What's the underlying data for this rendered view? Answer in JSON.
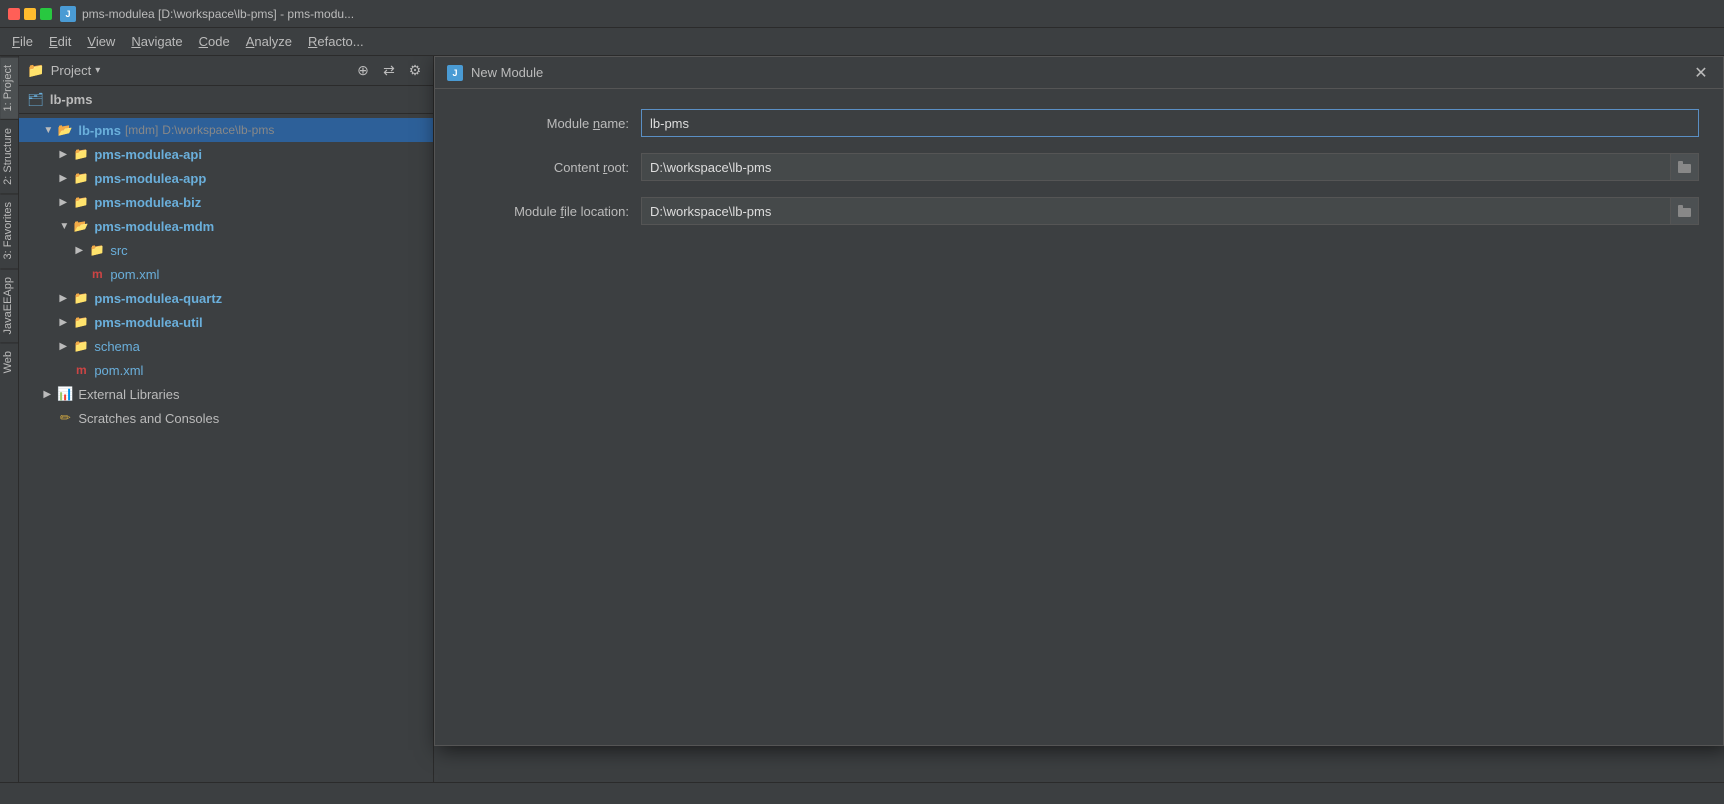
{
  "titleBar": {
    "icon": "J",
    "title": "pms-modulea [D:\\workspace\\lb-pms] - pms-modu...",
    "windowControls": [
      "red",
      "yellow",
      "green"
    ]
  },
  "menuBar": {
    "items": [
      {
        "label": "File",
        "underline": "F"
      },
      {
        "label": "Edit",
        "underline": "E"
      },
      {
        "label": "View",
        "underline": "V"
      },
      {
        "label": "Navigate",
        "underline": "N"
      },
      {
        "label": "Code",
        "underline": "C"
      },
      {
        "label": "Analyze",
        "underline": "A"
      },
      {
        "label": "Refacto...",
        "underline": "R"
      }
    ]
  },
  "projectPanel": {
    "label": "1: Project",
    "header": {
      "title": "Project",
      "dropdown": "▾"
    },
    "tree": {
      "rootItem": {
        "name": "lb-pms",
        "badge": "[mdm]",
        "path": "D:\\workspace\\lb-pms",
        "expanded": true,
        "selected": false,
        "children": [
          {
            "name": "pms-modulea-api",
            "type": "module",
            "expanded": false
          },
          {
            "name": "pms-modulea-app",
            "type": "module",
            "expanded": false
          },
          {
            "name": "pms-modulea-biz",
            "type": "module",
            "expanded": false
          },
          {
            "name": "pms-modulea-mdm",
            "type": "module",
            "expanded": true,
            "children": [
              {
                "name": "src",
                "type": "folder",
                "expanded": false
              },
              {
                "name": "pom.xml",
                "type": "maven"
              }
            ]
          },
          {
            "name": "pms-modulea-quartz",
            "type": "module",
            "expanded": false
          },
          {
            "name": "pms-modulea-util",
            "type": "module",
            "expanded": false
          },
          {
            "name": "schema",
            "type": "folder",
            "expanded": false
          },
          {
            "name": "pom.xml",
            "type": "maven"
          }
        ]
      },
      "externalLibraries": {
        "name": "External Libraries",
        "type": "external"
      },
      "scratchesConsoles": {
        "name": "Scratches and Consoles",
        "type": "scratch"
      }
    }
  },
  "sideLabels": {
    "left": [
      "Structure",
      "Favorites",
      "JavaEEApp",
      "Web"
    ],
    "right": []
  },
  "dialog": {
    "title": "New Module",
    "closeButton": "✕",
    "fields": {
      "moduleName": {
        "label": "Module name:",
        "value": "lb-pms",
        "underline": "n"
      },
      "contentRoot": {
        "label": "Content root:",
        "value": "D:\\workspace\\lb-pms",
        "underline": "r",
        "hasBrowse": true
      },
      "moduleFileLocation": {
        "label": "Module file location:",
        "value": "D:\\workspace\\lb-pms",
        "underline": "f",
        "hasBrowse": true
      }
    }
  },
  "ibLabel": {
    "text": "lb-pms",
    "icon": "🗂"
  }
}
